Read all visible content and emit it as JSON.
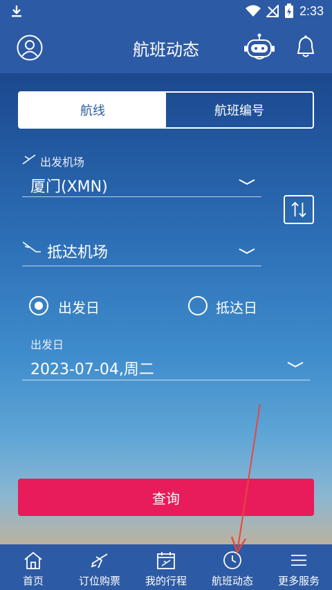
{
  "status_bar": {
    "time": "2:33"
  },
  "header": {
    "title": "航班动态"
  },
  "tabs": [
    {
      "label": "航线",
      "active": true
    },
    {
      "label": "航班编号",
      "active": false
    }
  ],
  "departure": {
    "label": "出发机场",
    "value": "厦门(XMN)"
  },
  "arrival": {
    "placeholder": "抵达机场"
  },
  "date_mode": {
    "options": [
      "出发日",
      "抵达日"
    ],
    "selected": "出发日"
  },
  "date": {
    "label": "出发日",
    "value": "2023-07-04,周二"
  },
  "query_button": "查询",
  "bottom_nav": [
    {
      "label": "首页",
      "icon": "home-icon"
    },
    {
      "label": "订位购票",
      "icon": "plane-icon"
    },
    {
      "label": "我的行程",
      "icon": "calendar-plane-icon"
    },
    {
      "label": "航班动态",
      "icon": "clock-icon",
      "active": true
    },
    {
      "label": "更多服务",
      "icon": "menu-icon"
    }
  ],
  "colors": {
    "primary": "#2d5aa4",
    "accent": "#e81c5a",
    "white": "#ffffff"
  }
}
